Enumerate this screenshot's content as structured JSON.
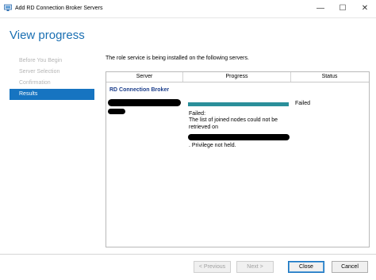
{
  "window": {
    "title": "Add RD Connection Broker Servers",
    "minimize_glyph": "—",
    "maximize_glyph": "☐",
    "close_glyph": "✕"
  },
  "page_title": "View progress",
  "nav": {
    "items": [
      {
        "label": "Before You Begin",
        "active": false
      },
      {
        "label": "Server Selection",
        "active": false
      },
      {
        "label": "Confirmation",
        "active": false
      },
      {
        "label": "Results",
        "active": true
      }
    ]
  },
  "description": "The role service is being installed on the following servers.",
  "grid": {
    "columns": [
      "Server",
      "Progress",
      "Status"
    ],
    "group_header": "RD Connection Broker",
    "row": {
      "progress_fraction": 1.0,
      "status": "Failed",
      "message_line1": "Failed:",
      "message_line2": "The list of joined nodes could not be retrieved on",
      "message_line3": ". Privilege not held."
    }
  },
  "buttons": {
    "previous": "< Previous",
    "next": "Next >",
    "close": "Close",
    "cancel": "Cancel"
  },
  "colors": {
    "accent": "#1674c1",
    "title_blue": "#1a6fb2",
    "progress": "#2a8f9a"
  },
  "icons": {
    "app": "server-manager-icon"
  }
}
